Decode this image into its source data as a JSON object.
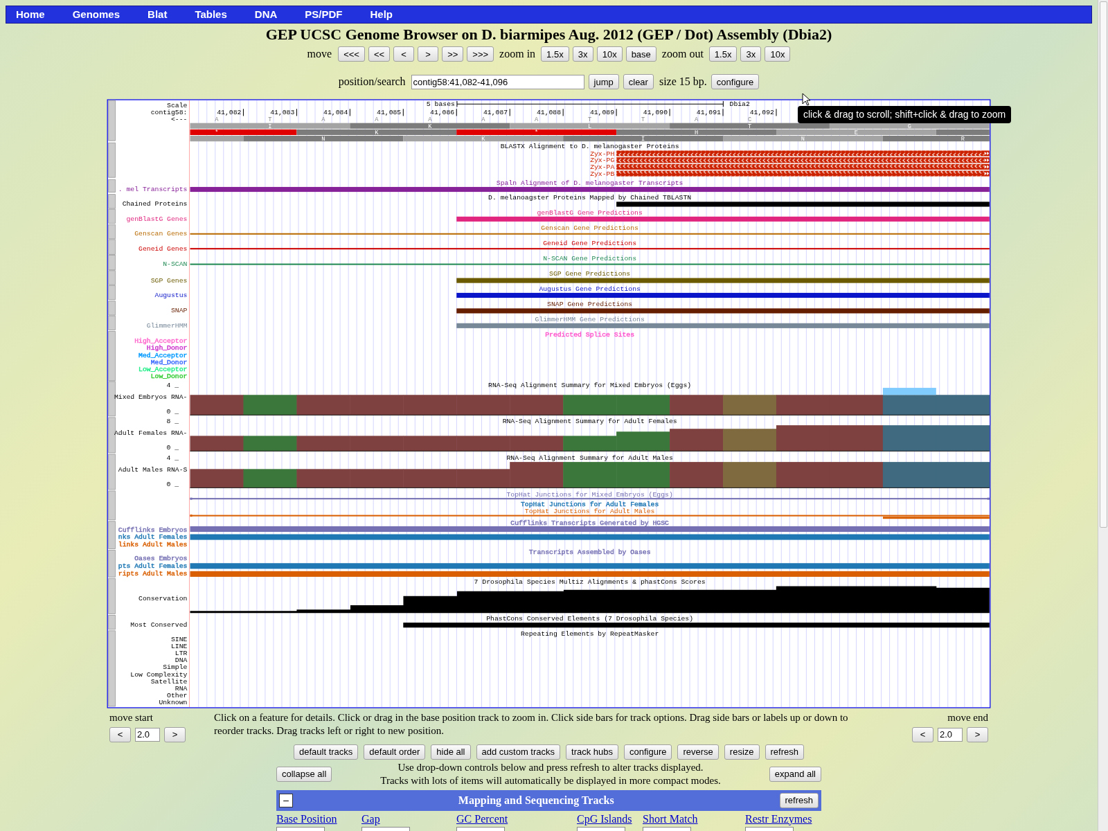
{
  "nav_menu": [
    {
      "label": "Home"
    },
    {
      "label": "Genomes"
    },
    {
      "label": "Blat"
    },
    {
      "label": "Tables"
    },
    {
      "label": "DNA"
    },
    {
      "label": "PS/PDF"
    },
    {
      "label": "Help"
    }
  ],
  "title": "GEP UCSC Genome Browser on D. biarmipes Aug. 2012 (GEP / Dot) Assembly (Dbia2)",
  "navigation": {
    "move_label": "move",
    "move_buttons": [
      "<<<",
      "<<",
      "<",
      ">",
      ">>",
      ">>>"
    ],
    "zoom_in_label": "zoom in",
    "zoom_in_buttons": [
      "1.5x",
      "3x",
      "10x",
      "base"
    ],
    "zoom_out_label": "zoom out",
    "zoom_out_buttons": [
      "1.5x",
      "3x",
      "10x"
    ]
  },
  "position": {
    "label": "position/search",
    "value": "contig58:41,082-41,096",
    "buttons": [
      "jump",
      "clear"
    ],
    "size": "size 15 bp.",
    "configure": "configure"
  },
  "tooltip": "click & drag to scroll; shift+click & drag to zoom",
  "ruler": {
    "scale_label": "Scale",
    "chrom_label": "contig58:",
    "strand": "<---",
    "scale_text": "5 bases",
    "assembly": "Dbia2",
    "positions": [
      "41,082",
      "41,083",
      "41,084",
      "41,085",
      "41,086",
      "41,087",
      "41,088",
      "41,089",
      "41,090",
      "41,091",
      "41,092"
    ],
    "bases": [
      "A",
      "T",
      "A",
      "A",
      "A",
      "A",
      "A",
      "T",
      "T",
      "A",
      "C"
    ],
    "frames": [
      [
        {
          "aa": "I",
          "dark": false,
          "stop": false
        },
        {
          "aa": "K",
          "dark": true,
          "stop": false
        },
        {
          "aa": "L",
          "dark": false,
          "stop": false
        },
        {
          "aa": "T",
          "dark": true,
          "stop": false
        },
        {
          "aa": "G",
          "dark": false,
          "stop": false
        }
      ],
      [
        {
          "aa": "*",
          "stop": true
        },
        {
          "aa": "K",
          "dark": true,
          "stop": false
        },
        {
          "aa": "*",
          "stop": true
        },
        {
          "aa": "H",
          "dark": true,
          "stop": false
        },
        {
          "aa": "E",
          "dark": false,
          "stop": false
        },
        {
          "dark": true,
          "stop": false
        }
      ],
      [
        {
          "dark": false,
          "stop": false
        },
        {
          "aa": "N",
          "dark": true,
          "stop": false
        },
        {
          "aa": "K",
          "dark": false,
          "stop": false
        },
        {
          "aa": "I",
          "dark": true,
          "stop": false
        },
        {
          "aa": "N",
          "dark": false,
          "stop": false
        },
        {
          "aa": "R",
          "dark": true,
          "stop": false
        }
      ]
    ]
  },
  "tracks": [
    {
      "kind": "blastx",
      "title": "BLASTX Alignment to D. melanogaster Proteins",
      "color": "#cc2200",
      "items": [
        {
          "label": "Zyx-PH"
        },
        {
          "label": "Zyx-PG"
        },
        {
          "label": "Zyx-PA"
        },
        {
          "label": "Zyx-PB"
        }
      ]
    },
    {
      "kind": "bar",
      "title": "Spaln Alignment of D. melanogaster Transcripts",
      "label": ". mel Transcripts",
      "color": "#882299"
    },
    {
      "kind": "bar",
      "title": "D. melanoagster Proteins Mapped by Chained TBLASTN",
      "label": "Chained Proteins",
      "color": "#000000"
    },
    {
      "kind": "bar",
      "title": "genBlastG Gene Predictions",
      "label": "genBlastG Genes",
      "color": "#e0267f"
    },
    {
      "kind": "line",
      "title": "Genscan Gene Predictions",
      "label": "Genscan Genes",
      "color": "#b86a00"
    },
    {
      "kind": "line",
      "title": "Geneid Gene Predictions",
      "label": "Geneid Genes",
      "color": "#cc0000"
    },
    {
      "kind": "line",
      "title": "N-SCAN Gene Predictions",
      "label": "N-SCAN",
      "color": "#228b55"
    },
    {
      "kind": "bar",
      "title": "SGP Gene Predictions",
      "label": "SGP Genes",
      "color": "#6b5a00"
    },
    {
      "kind": "bar",
      "title": "Augustus Gene Predictions",
      "label": "Augustus",
      "color": "#0a14c8"
    },
    {
      "kind": "bar",
      "title": "SNAP Gene Predictions",
      "label": "SNAP",
      "color": "#661e00"
    },
    {
      "kind": "bar",
      "title": "GlimmerHMM Gene Predictions",
      "label": "GlimmerHMM",
      "color": "#778899"
    },
    {
      "kind": "splice",
      "title": "Predicted Splice Sites",
      "color": "#ff55cc",
      "items": [
        {
          "label": "High_Acceptor",
          "color": "#ff66cc"
        },
        {
          "label": "High_Donor",
          "color": "#cc33cc"
        },
        {
          "label": "Med_Acceptor",
          "color": "#0099ff"
        },
        {
          "label": "Med_Donor",
          "color": "#3366ff"
        },
        {
          "label": "Low_Acceptor",
          "color": "#22ee88"
        },
        {
          "label": "Low_Donor",
          "color": "#33cc33"
        }
      ]
    },
    {
      "kind": "rnaseq",
      "title": "RNA-Seq Alignment Summary for Mixed Embryos (Eggs)",
      "label": "Mixed Embryos RNA-",
      "max": "4 _",
      "min": "0 _"
    },
    {
      "kind": "rnaseq",
      "title": "RNA-Seq Alignment Summary for Adult Females",
      "label": "Adult Females RNA-",
      "max": "8 _",
      "min": "0 _"
    },
    {
      "kind": "rnaseq",
      "title": "RNA-Seq Alignment Summary for Adult Males",
      "label": "Adult Males RNA-S",
      "max": "4 _",
      "min": "0 _"
    },
    {
      "kind": "junctions",
      "items": [
        {
          "title": "TopHat Junctions for Mixed Embryos (Eggs)",
          "color": "#7570b3"
        },
        {
          "title": "TopHat Junctions for Adult Females",
          "color": "#1f78b4"
        },
        {
          "title": "TopHat Junctions for Adult Males",
          "color": "#d95f02"
        }
      ]
    },
    {
      "kind": "composite",
      "title": "Cufflinks Transcripts Generated by HGSC",
      "color": "#7570b3",
      "items": [
        {
          "label": "Cufflinks Embryos",
          "color": "#7570b3",
          "feature": true
        },
        {
          "label": "nks Adult Females",
          "color": "#1f78b4",
          "feature": true
        },
        {
          "label": "links Adult Males",
          "color": "#d95f02",
          "feature": false
        }
      ]
    },
    {
      "kind": "composite",
      "title": "Transcripts Assembled by Oases",
      "color": "#7570b3",
      "items": [
        {
          "label": "Oases Embryos",
          "color": "#7570b3",
          "feature": false
        },
        {
          "label": "pts Adult Females",
          "color": "#1f78b4",
          "feature": true
        },
        {
          "label": "ripts Adult Males",
          "color": "#d95f02",
          "feature": true
        }
      ]
    },
    {
      "kind": "conservation",
      "title": "7 Drosophila Species Multiz Alignments & phastCons Scores",
      "label": "Conservation"
    },
    {
      "kind": "bar",
      "title": "PhastCons Conserved Elements (7 Drosophila Species)",
      "label": "Most Conserved",
      "color": "#000000"
    },
    {
      "kind": "repeat",
      "title": "Repeating Elements by RepeatMasker",
      "labels": [
        "SINE",
        "LINE",
        "LTR",
        "DNA",
        "Simple",
        "Low Complexity",
        "Satellite",
        "RNA",
        "Other",
        "Unknown"
      ]
    }
  ],
  "move_start": {
    "label": "move start",
    "buttons": [
      "<",
      ">"
    ],
    "value": "2.0"
  },
  "move_end": {
    "label": "move end",
    "buttons": [
      "<",
      ">"
    ],
    "value": "2.0"
  },
  "help_text": "Click on a feature for details. Click or drag in the base position track to zoom in. Click side bars for track options. Drag side bars or labels up or down to reorder tracks. Drag tracks left or right to new position.",
  "actions": [
    "default tracks",
    "default order",
    "hide all",
    "add custom tracks",
    "track hubs",
    "configure",
    "reverse",
    "resize",
    "refresh"
  ],
  "collapse_all": "collapse all",
  "expand_all": "expand all",
  "notes": [
    "Use drop-down controls below and press refresh to alter tracks displayed.",
    "Tracks with lots of items will automatically be displayed in more compact modes."
  ],
  "group": {
    "toggle": "–",
    "title": "Mapping and Sequencing Tracks",
    "refresh": "refresh",
    "links": [
      "Base Position",
      "Gap",
      "GC Percent",
      "CpG Islands",
      "Short Match",
      "Restr Enzymes"
    ]
  }
}
